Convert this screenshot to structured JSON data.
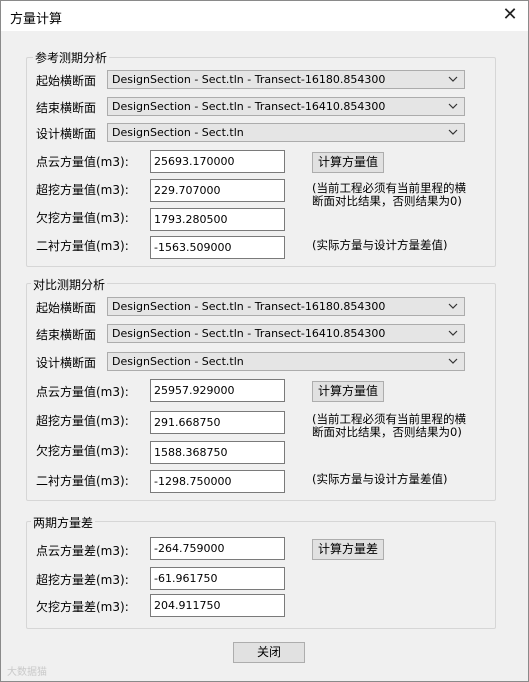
{
  "window": {
    "title": "方量计算",
    "close_glyph": "✕"
  },
  "group1": {
    "legend": "参考测期分析",
    "start_label": "起始横断面",
    "start_value": "DesignSection - Sect.tln - Transect-16180.854300",
    "end_label": "结束横断面",
    "end_value": "DesignSection - Sect.tln - Transect-16410.854300",
    "design_label": "设计横断面",
    "design_value": "DesignSection - Sect.tln",
    "cloud_label": "点云方量值(m3):",
    "cloud_value": "25693.170000",
    "calc_button": "计算方量值",
    "over_label": "超挖方量值(m3):",
    "over_value": "229.707000",
    "note1_line1": "(当前工程必须有当前里程的横",
    "note1_line2": "断面对比结果，否则结果为0)",
    "under_label": "欠挖方量值(m3):",
    "under_value": "1793.280500",
    "lining_label": "二衬方量值(m3):",
    "lining_value": "-1563.509000",
    "note2": "(实际方量与设计方量差值)"
  },
  "group2": {
    "legend": "对比测期分析",
    "start_label": "起始横断面",
    "start_value": "DesignSection - Sect.tln - Transect-16180.854300",
    "end_label": "结束横断面",
    "end_value": "DesignSection - Sect.tln - Transect-16410.854300",
    "design_label": "设计横断面",
    "design_value": "DesignSection - Sect.tln",
    "cloud_label": "点云方量值(m3):",
    "cloud_value": "25957.929000",
    "calc_button": "计算方量值",
    "over_label": "超挖方量值(m3):",
    "over_value": "291.668750",
    "note1_line1": "(当前工程必须有当前里程的横",
    "note1_line2": "断面对比结果，否则结果为0)",
    "under_label": "欠挖方量值(m3):",
    "under_value": "1588.368750",
    "lining_label": "二衬方量值(m3):",
    "lining_value": "-1298.750000",
    "note2": "(实际方量与设计方量差值)"
  },
  "group3": {
    "legend": "两期方量差",
    "cloud_label": "点云方量差(m3):",
    "cloud_value": "-264.759000",
    "calc_button": "计算方量差",
    "over_label": "超挖方量差(m3):",
    "over_value": "-61.961750",
    "under_label": "欠挖方量差(m3):",
    "under_value": "204.911750"
  },
  "footer": {
    "close_button": "关闭",
    "watermark": "大数据猫"
  }
}
